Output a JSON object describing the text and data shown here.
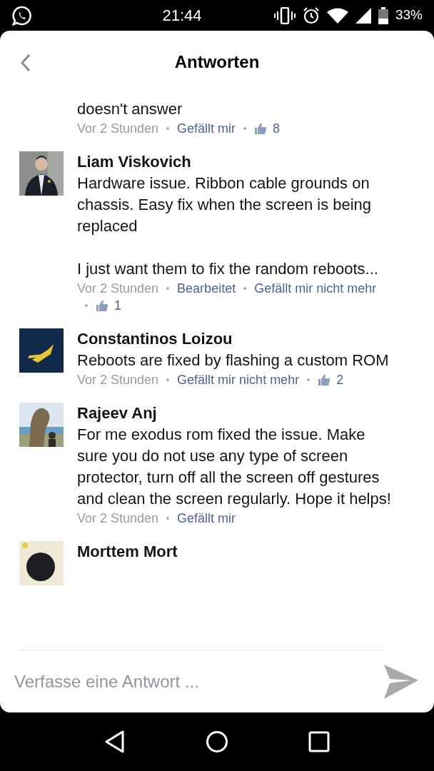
{
  "status_bar": {
    "time": "21:44",
    "battery": "33%"
  },
  "header": {
    "title": "Antworten"
  },
  "comments": [
    {
      "paragraphs": [
        "doesn't answer"
      ],
      "meta": [
        {
          "kind": "time",
          "text": "Vor 2 Stunden"
        },
        {
          "kind": "link",
          "text": "Gefällt mir"
        },
        {
          "kind": "likes",
          "text": "8"
        }
      ]
    },
    {
      "author": "Liam Viskovich",
      "avatar": {
        "kind": "picture"
      },
      "paragraphs": [
        "Hardware issue. Ribbon cable grounds on chassis. Easy fix when the screen is being replaced",
        "I just want them to fix the random reboots..."
      ],
      "meta": [
        {
          "kind": "time",
          "text": "Vor 2 Stunden"
        },
        {
          "kind": "link",
          "text": "Bearbeitet"
        },
        {
          "kind": "link",
          "text": "Gefällt mir nicht mehr"
        },
        {
          "kind": "likes",
          "text": "1"
        }
      ]
    },
    {
      "author": "Constantinos Loizou",
      "avatar": {
        "kind": "picture"
      },
      "paragraphs": [
        "Reboots are fixed by flashing a custom ROM"
      ],
      "meta": [
        {
          "kind": "time",
          "text": "Vor 2 Stunden"
        },
        {
          "kind": "link",
          "text": "Gefällt mir nicht mehr"
        },
        {
          "kind": "likes",
          "text": "2"
        }
      ]
    },
    {
      "author": "Rajeev Anj",
      "avatar": {
        "kind": "picture"
      },
      "paragraphs": [
        "For me exodus rom fixed the issue. Make sure you do not use any type of screen protector, turn off all the screen off gestures and clean the screen regularly. Hope it helps!"
      ],
      "meta": [
        {
          "kind": "time",
          "text": "Vor 2 Stunden"
        },
        {
          "kind": "link",
          "text": "Gefällt mir"
        }
      ]
    },
    {
      "author": "Morttem Mort",
      "avatar": {
        "kind": "picture"
      }
    }
  ],
  "reply_field": {
    "placeholder": "Verfasse eine Antwort ..."
  }
}
